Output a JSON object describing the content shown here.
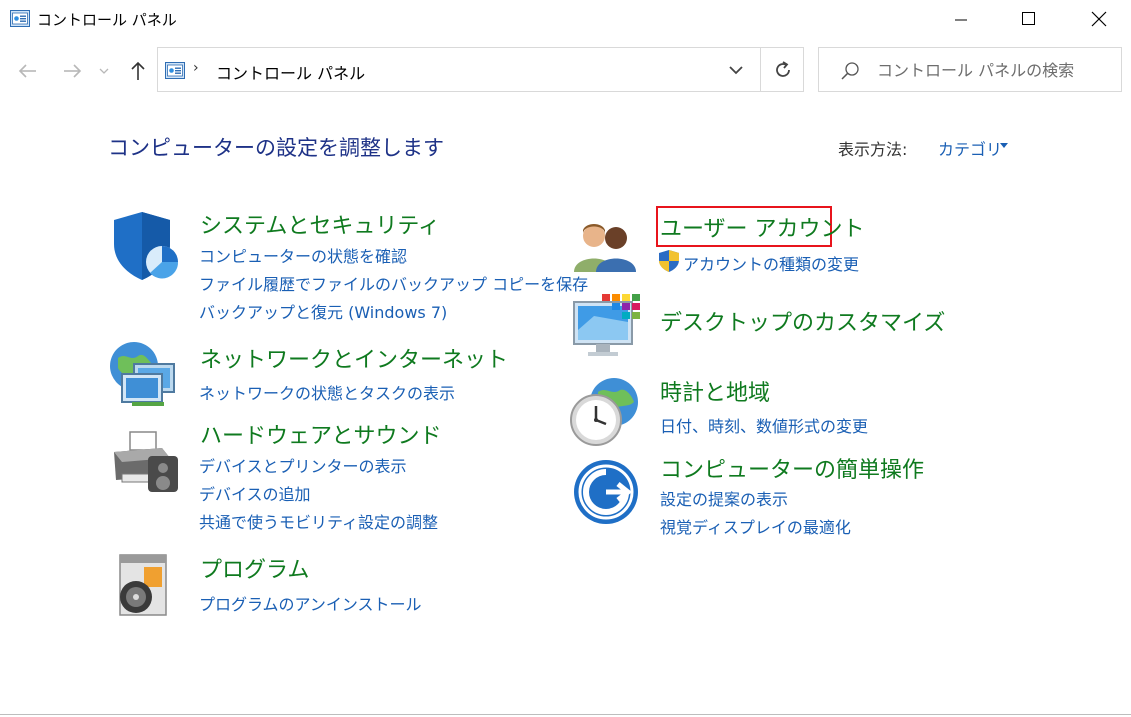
{
  "window": {
    "title": "コントロール パネル",
    "icon": "control-panel-icon"
  },
  "address": {
    "path": "コントロール パネル",
    "separator": "›"
  },
  "search": {
    "placeholder": "コントロール パネルの検索"
  },
  "header": {
    "title": "コンピューターの設定を調整します",
    "view_by_label": "表示方法:",
    "view_by_value": "カテゴリ"
  },
  "categories": {
    "system": {
      "title": "システムとセキュリティ",
      "icon": "shield-icon",
      "links": [
        "コンピューターの状態を確認",
        "ファイル履歴でファイルのバックアップ コピーを保存",
        "バックアップと復元 (Windows 7)"
      ]
    },
    "network": {
      "title": "ネットワークとインターネット",
      "icon": "network-icon",
      "links": [
        "ネットワークの状態とタスクの表示"
      ]
    },
    "hardware": {
      "title": "ハードウェアとサウンド",
      "icon": "printer-icon",
      "links": [
        "デバイスとプリンターの表示",
        "デバイスの追加",
        "共通で使うモビリティ設定の調整"
      ]
    },
    "programs": {
      "title": "プログラム",
      "icon": "programs-icon",
      "links": [
        "プログラムのアンインストール"
      ]
    },
    "users": {
      "title": "ユーザー アカウント",
      "icon": "users-icon",
      "links": [
        "アカウントの種類の変更"
      ]
    },
    "appearance": {
      "title": "デスクトップのカスタマイズ",
      "icon": "desktop-icon",
      "links": []
    },
    "clock": {
      "title": "時計と地域",
      "icon": "clock-icon",
      "links": [
        "日付、時刻、数値形式の変更"
      ]
    },
    "ease": {
      "title": "コンピューターの簡単操作",
      "icon": "ease-of-access-icon",
      "links": [
        "設定の提案の表示",
        "視覚ディスプレイの最適化"
      ]
    }
  },
  "colors": {
    "heading": "#1e3287",
    "category_title": "#0f7a1f",
    "link": "#1a5fb4",
    "highlight": "#e8141c"
  }
}
